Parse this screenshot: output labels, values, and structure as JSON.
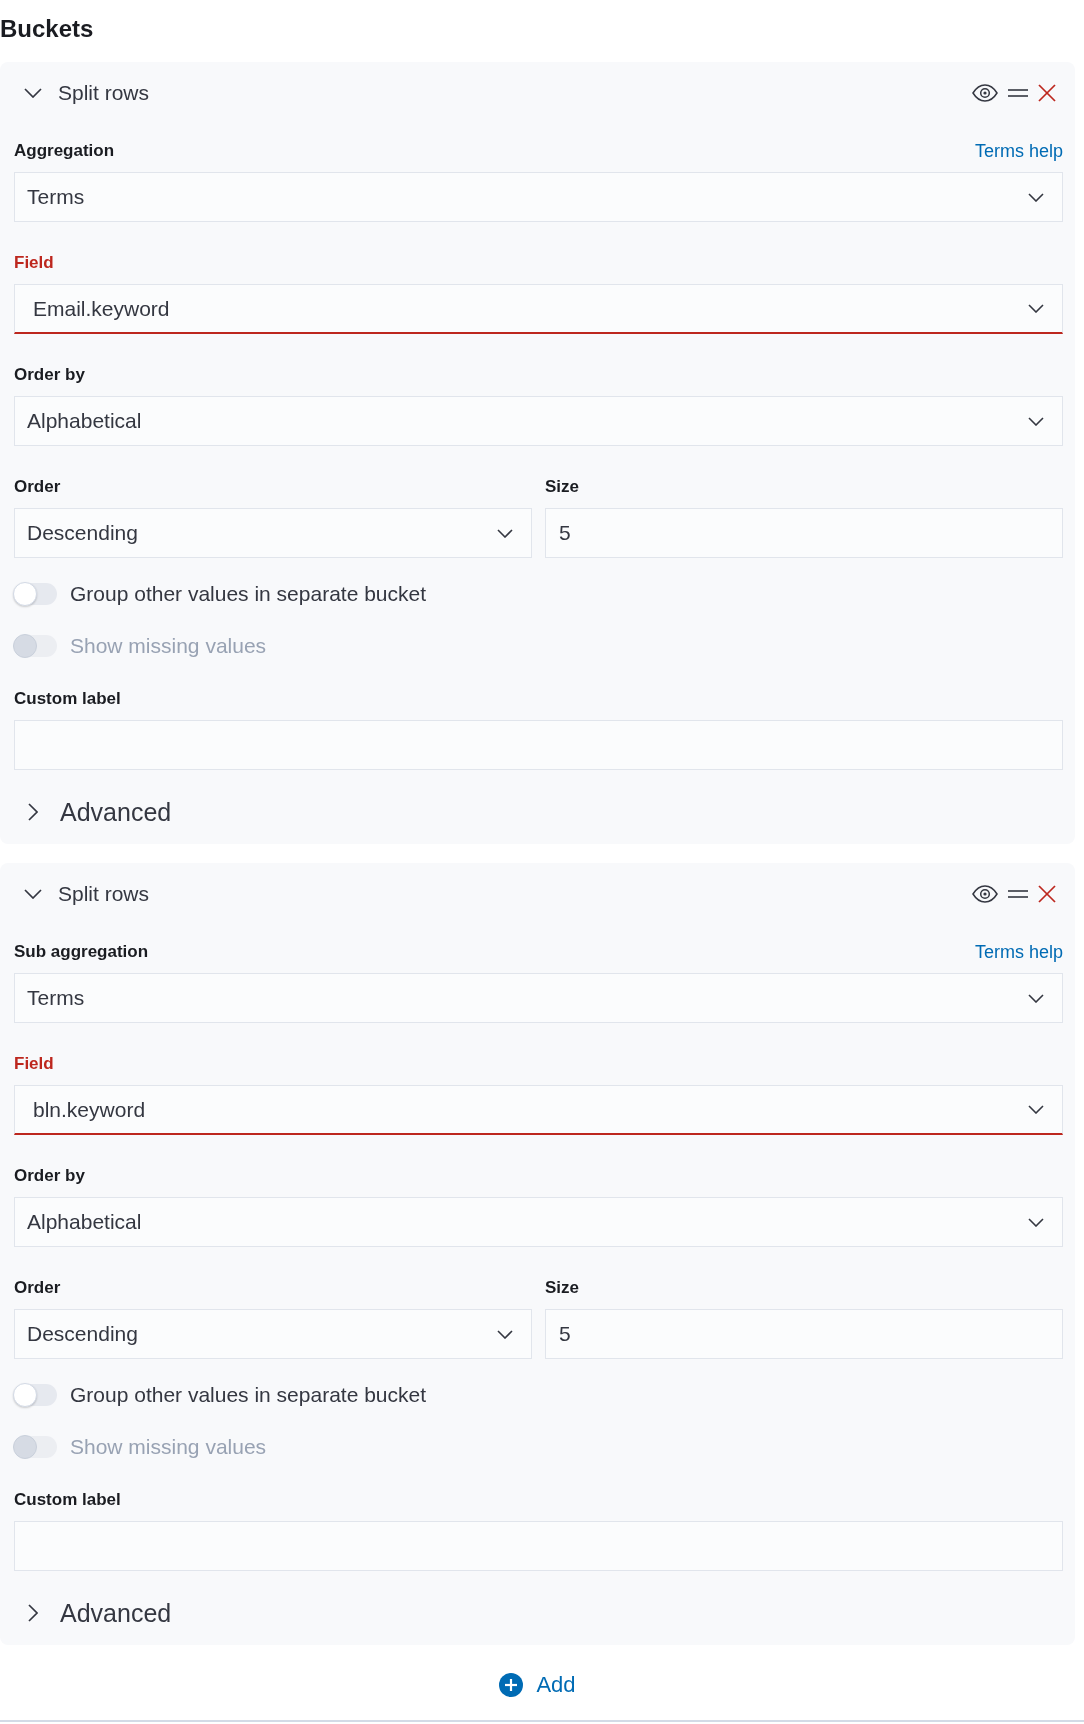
{
  "title": "Buckets",
  "panels": [
    {
      "title": "Split rows",
      "expanded": true,
      "controls": [
        {
          "kind": "select",
          "label": "Aggregation",
          "help": "Terms help",
          "value": "Terms",
          "invalid": false
        },
        {
          "kind": "combobox",
          "label": "Field",
          "value": "Email.keyword",
          "invalid": true
        },
        {
          "kind": "select",
          "label": "Order by",
          "value": "Alphabetical",
          "invalid": false
        },
        {
          "kind": "pair",
          "items": [
            {
              "kind": "select",
              "label": "Order",
              "value": "Descending",
              "invalid": false
            },
            {
              "kind": "number",
              "label": "Size",
              "value": "5",
              "invalid": false
            }
          ]
        },
        {
          "kind": "switch",
          "label": "Group other values in separate bucket",
          "on": false,
          "disabled": false
        },
        {
          "kind": "switch",
          "label": "Show missing values",
          "on": false,
          "disabled": true
        },
        {
          "kind": "text",
          "label": "Custom label",
          "invalid": false
        }
      ],
      "advanced": {
        "label": "Advanced",
        "expanded": false
      }
    },
    {
      "title": "Split rows",
      "expanded": true,
      "controls": [
        {
          "kind": "select",
          "label": "Sub aggregation",
          "help": "Terms help",
          "value": "Terms",
          "invalid": false
        },
        {
          "kind": "combobox",
          "label": "Field",
          "value": "bln.keyword",
          "invalid": true
        },
        {
          "kind": "select",
          "label": "Order by",
          "value": "Alphabetical",
          "invalid": false
        },
        {
          "kind": "pair",
          "items": [
            {
              "kind": "select",
              "label": "Order",
              "value": "Descending",
              "invalid": false
            },
            {
              "kind": "number",
              "label": "Size",
              "value": "5",
              "invalid": false
            }
          ]
        },
        {
          "kind": "switch",
          "label": "Group other values in separate bucket",
          "on": false,
          "disabled": false
        },
        {
          "kind": "switch",
          "label": "Show missing values",
          "on": false,
          "disabled": true
        },
        {
          "kind": "text",
          "label": "Custom label",
          "invalid": false
        }
      ],
      "advanced": {
        "label": "Advanced",
        "expanded": false
      }
    }
  ],
  "add_button": {
    "label": "Add"
  }
}
